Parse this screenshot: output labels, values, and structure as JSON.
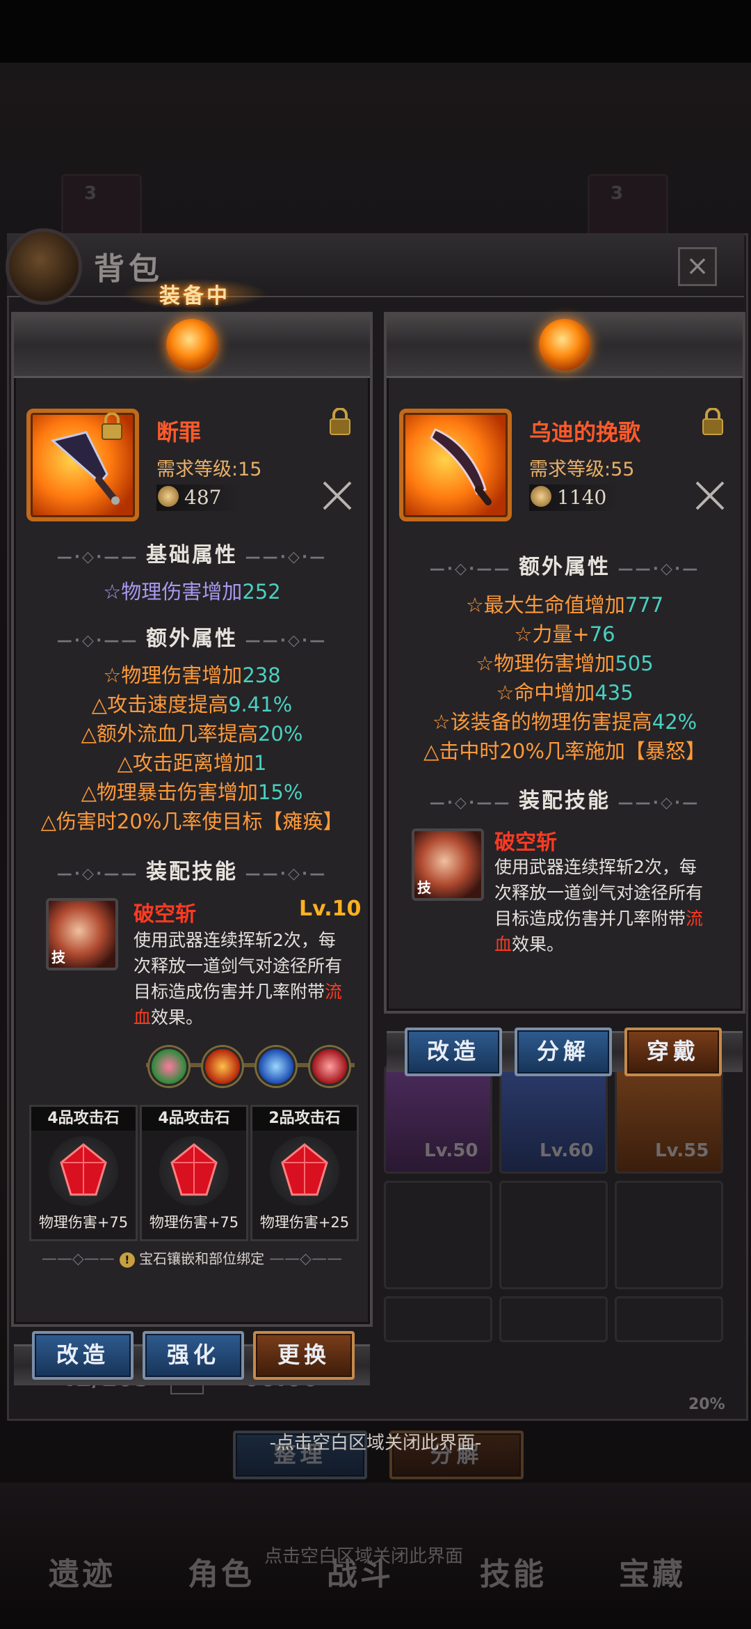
{
  "background": {
    "bag_title": "背包",
    "inventory_count": "42/105",
    "timer": "00:00",
    "percent": "20%",
    "sort_button": "整理",
    "decompose_button": "分解",
    "bottom_hint": "点击空白区域关闭此界面",
    "bottom_nav": [
      "遗迹",
      "角色",
      "战斗",
      "技能",
      "宝藏"
    ],
    "slot_badge": "3",
    "grid_levels": [
      "Lv.50",
      "Lv.60",
      "Lv.55"
    ]
  },
  "equipped_tab": "装备中",
  "left_item": {
    "name": "断罪",
    "requirement": "需求等级:15",
    "score": "487",
    "base_title": "基础属性",
    "base_attrs": [
      {
        "prefix": "☆物理伤害增加",
        "value": "252"
      }
    ],
    "extra_title": "额外属性",
    "extra_attrs": [
      {
        "prefix": "☆物理伤害增加",
        "value": "238",
        "color": "orange"
      },
      {
        "prefix": "△攻击速度提高",
        "value": "9.41%",
        "color": "orange"
      },
      {
        "prefix": "△额外流血几率提高",
        "value": "20%",
        "color": "orange"
      },
      {
        "prefix": "△攻击距离增加",
        "value": "1",
        "color": "orange"
      },
      {
        "prefix": "△物理暴击伤害增加",
        "value": "15%",
        "color": "orange"
      },
      {
        "prefix": "△伤害时20%几率使目标【瘫痪】",
        "value": "",
        "color": "orange"
      }
    ],
    "skill_title": "装配技能",
    "skill": {
      "name": "破空斩",
      "level": "Lv.10",
      "tag": "技",
      "desc_1": "使用武器连续挥斩2次，每",
      "desc_2": "次释放一道剑气对途径所有",
      "desc_3a": "目标造成伤害并几率附带",
      "desc_3b": "流",
      "desc_4a": "血",
      "desc_4b": "效果。"
    },
    "gems": [
      {
        "label": "4品攻击石",
        "stat": "物理伤害+75"
      },
      {
        "label": "4品攻击石",
        "stat": "物理伤害+75"
      },
      {
        "label": "2品攻击石",
        "stat": "物理伤害+25"
      }
    ],
    "gem_note": "宝石镶嵌和部位绑定",
    "buttons": {
      "reforge": "改造",
      "enhance": "强化",
      "replace": "更换"
    }
  },
  "right_item": {
    "name": "乌迪的挽歌",
    "requirement": "需求等级:55",
    "score": "1140",
    "extra_title": "额外属性",
    "extra_attrs": [
      {
        "prefix": "☆最大生命值增加",
        "value": "777"
      },
      {
        "prefix": "☆力量+",
        "value": "76"
      },
      {
        "prefix": "☆物理伤害增加",
        "value": "505"
      },
      {
        "prefix": "☆命中增加",
        "value": "435"
      },
      {
        "prefix": "☆该装备的物理伤害提高",
        "value": "42%"
      },
      {
        "prefix": "△击中时20%几率施加【暴怒】",
        "value": ""
      }
    ],
    "skill_title": "装配技能",
    "skill": {
      "name": "破空斩",
      "tag": "技",
      "desc_1": "使用武器连续挥斩2次，每",
      "desc_2": "次释放一道剑气对途径所有",
      "desc_3a": "目标造成伤害并几率附带",
      "desc_3b": "流",
      "desc_4a": "血",
      "desc_4b": "效果。"
    },
    "buttons": {
      "reforge": "改造",
      "decompose": "分解",
      "equip": "穿戴"
    }
  },
  "close_hint": "-点击空白区域关闭此界面-",
  "colors": {
    "accent_orange": "#ff9a3a",
    "value_teal": "#4ad0c0",
    "name_red": "#ff3a22",
    "base_purple": "#a79af0"
  },
  "icons": [
    "bag-icon",
    "close-icon",
    "lock-icon",
    "crossed-swords-icon",
    "trophy-icon",
    "gem-icon",
    "warning-icon"
  ]
}
